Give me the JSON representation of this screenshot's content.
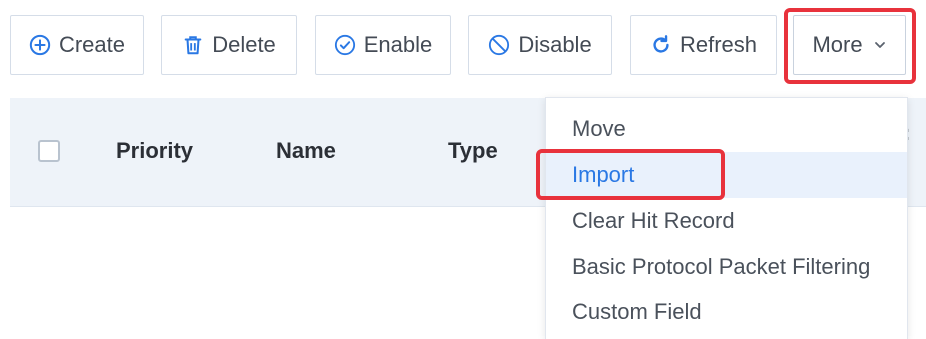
{
  "toolbar": {
    "buttons": [
      {
        "label": "Create",
        "icon": "plus-circle-icon"
      },
      {
        "label": "Delete",
        "icon": "trash-icon"
      },
      {
        "label": "Enable",
        "icon": "check-circle-icon"
      },
      {
        "label": "Disable",
        "icon": "ban-icon"
      },
      {
        "label": "Refresh",
        "icon": "refresh-icon"
      },
      {
        "label": "More",
        "icon": "chevron-down-icon"
      }
    ]
  },
  "table": {
    "columns": [
      "Priority",
      "Name",
      "Type"
    ],
    "partial_header_glyph": ":"
  },
  "dropdown": {
    "items": [
      "Move",
      "Import",
      "Clear Hit Record",
      "Basic Protocol Packet Filtering",
      "Custom Field"
    ],
    "hovered_item": "Import"
  },
  "colors": {
    "accent": "#2a78e4",
    "highlight": "#e8323c",
    "header_bg": "#eef3f9",
    "hover_bg": "#e9f1fc"
  }
}
